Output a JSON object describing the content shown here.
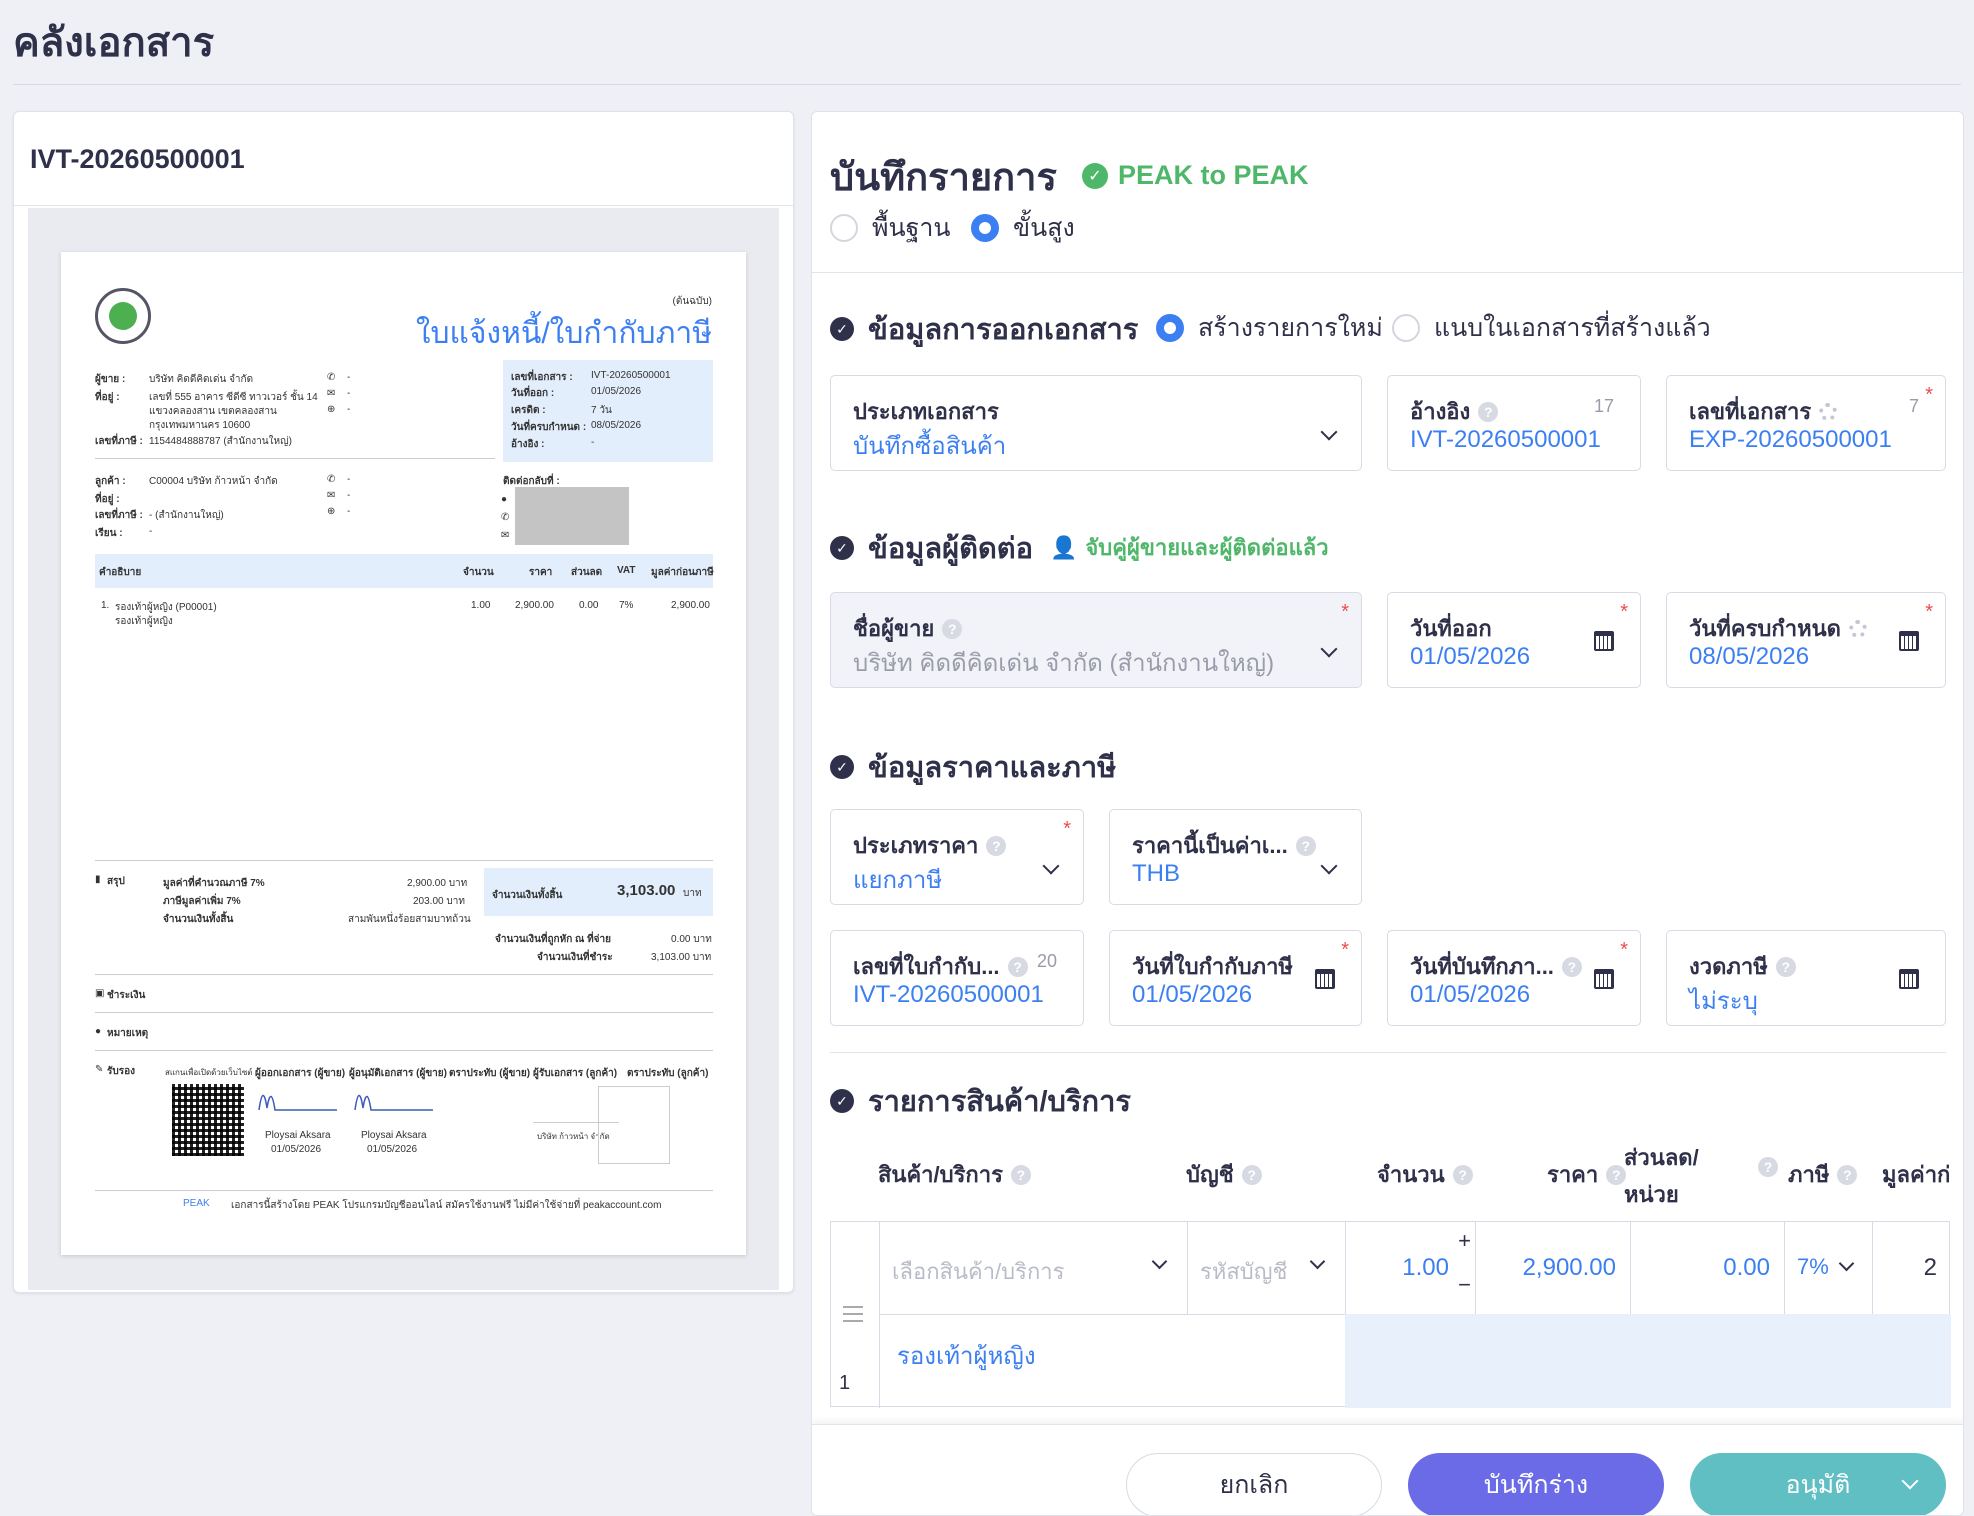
{
  "page": {
    "title": "คลังเอกสาร"
  },
  "preview": {
    "doc_number": "IVT-20260500001",
    "doc": {
      "copy_label": "(ต้นฉบับ)",
      "title": "ใบแจ้งหนี้/ใบกำกับภาษี",
      "seller_label": "ผู้ขาย :",
      "seller": "บริษัท คิดดีคิดเด่น จำกัด",
      "address_label": "ที่อยู่ :",
      "address1": "เลขที่ 555 อาคาร ซีดีซี ทาวเวอร์ ชั้น 14",
      "address2": "แขวงคลองสาน เขตคลองสาน",
      "address3": "กรุงเทพมหานคร 10600",
      "taxid_label": "เลขที่ภาษี :",
      "taxid": "1154484888787 (สำนักงานใหญ่)",
      "contact_dash": "-",
      "info_doc_label": "เลขที่เอกสาร :",
      "info_doc": "IVT-20260500001",
      "info_date_label": "วันที่ออก :",
      "info_date": "01/05/2026",
      "info_credit_label": "เครดิต :",
      "info_credit": "7 วัน",
      "info_due_label": "วันที่ครบกำหนด :",
      "info_due": "08/05/2026",
      "info_ref_label": "อ้างอิง :",
      "info_ref": "-",
      "customer_label": "ลูกค้า :",
      "customer": "C00004 บริษัท ก้าวหน้า จำกัด",
      "cust_addr_label": "ที่อยู่ :",
      "cust_tax_label": "เลขที่ภาษี :",
      "cust_tax": "- (สำนักงานใหญ่)",
      "attn_label": "เรียน :",
      "attn": "-",
      "contact_label": "ติดต่อกลับที่ :",
      "th_desc": "คำอธิบาย",
      "th_qty": "จำนวน",
      "th_price": "ราคา",
      "th_disc": "ส่วนลด",
      "th_vat": "VAT",
      "th_amount": "มูลค่าก่อนภาษี",
      "row_no": "1.",
      "row_name": "รองเท้าผู้หญิง (P00001)",
      "row_sub": "รองเท้าผู้หญิง",
      "row_qty": "1.00",
      "row_price": "2,900.00",
      "row_disc": "0.00",
      "row_vat": "7%",
      "row_amount": "2,900.00",
      "summary_label": "สรุป",
      "sum_base_label": "มูลค่าที่คำนวณภาษี 7%",
      "sum_base": "2,900.00 บาท",
      "sum_vat_label": "ภาษีมูลค่าเพิ่ม 7%",
      "sum_vat": "203.00 บาท",
      "sum_total_label": "จำนวนเงินทั้งสิ้น",
      "sum_words": "สามพันหนึ่งร้อยสามบาทถ้วน",
      "grand_label": "จำนวนเงินทั้งสิ้น",
      "grand_value": "3,103.00",
      "grand_unit": "บาท",
      "wht_label": "จำนวนเงินที่ถูกหัก ณ ที่จ่าย",
      "wht": "0.00 บาท",
      "paid_label": "จำนวนเงินที่ชำระ",
      "paid": "3,103.00 บาท",
      "payment_label": "ชำระเงิน",
      "notes_label": "หมายเหตุ",
      "approve_label": "รับรอง",
      "scan_label": "สแกนเพื่อเปิดด้วยเว็บไซต์",
      "issuer_label": "ผู้ออกเอกสาร (ผู้ขาย)",
      "approver_label": "ผู้อนุมัติเอกสาร (ผู้ขาย)",
      "seller_stamp_label": "ตราประทับ (ผู้ขาย)",
      "receiver_label": "ผู้รับเอกสาร (ลูกค้า)",
      "customer_stamp_label": "ตราประทับ (ลูกค้า)",
      "signer1": "Ploysai Aksara",
      "signer1_date": "01/05/2026",
      "signer2": "Ploysai Aksara",
      "signer2_date": "01/05/2026",
      "receiver_company": "บริษัท ก้าวหน้า จำกัด",
      "footer_brand": "PEAK",
      "footer_text": "เอกสารนี้สร้างโดย PEAK โปรแกรมบัญชีออนไลน์ สมัครใช้งานฟรี ไม่มีค่าใช้จ่ายที่ peakaccount.com"
    }
  },
  "form": {
    "title": "บันทึกรายการ",
    "badge": "PEAK to PEAK",
    "mode_basic": "พื้นฐาน",
    "mode_advanced": "ขั้นสูง",
    "sec_issue": "ข้อมูลการออกเอกสาร",
    "issue_new": "สร้างรายการใหม่",
    "issue_attach": "แนบในเอกสารที่สร้างแล้ว",
    "doc_type_label": "ประเภทเอกสาร",
    "doc_type": "บันทึกซื้อสินค้า",
    "ref_label": "อ้างอิง",
    "ref_count": "17",
    "ref_value": "IVT-20260500001",
    "docno_label": "เลขที่เอกสาร",
    "docno_count": "7",
    "docno_value": "EXP-20260500001",
    "sec_contact": "ข้อมูลผู้ติดต่อ",
    "matched": "จับคู่ผู้ขายและผู้ติดต่อแล้ว",
    "vendor_label": "ชื่อผู้ขาย",
    "vendor_value": "บริษัท คิดดีคิดเด่น จำกัด (สำนักงานใหญ่)",
    "issue_date_label": "วันที่ออก",
    "issue_date": "01/05/2026",
    "due_date_label": "วันที่ครบกำหนด",
    "due_date": "08/05/2026",
    "sec_price": "ข้อมูลราคาและภาษี",
    "price_type_label": "ประเภทราคา",
    "price_type": "แยกภาษี",
    "currency_label": "ราคานี้เป็นค่าเ...",
    "currency": "THB",
    "taxinv_label": "เลขที่ใบกำกับ...",
    "taxinv_count": "20",
    "taxinv_value": "IVT-20260500001",
    "taxinv_date_label": "วันที่ใบกำกับภาษี",
    "taxinv_date": "01/05/2026",
    "record_date_label": "วันที่บันทึกภา...",
    "record_date": "01/05/2026",
    "tax_period_label": "งวดภาษี",
    "tax_period": "ไม่ระบุ",
    "req_mark": "*",
    "qmark": "?",
    "sec_items": "รายการสินค้า/บริการ",
    "col_product": "สินค้า/บริการ",
    "col_account": "บัญชี",
    "col_qty": "จำนวน",
    "col_price": "ราคา",
    "col_disc1": "ส่วนลด/",
    "col_disc2": "หน่วย",
    "col_tax": "ภาษี",
    "col_value": "มูลค่าก่",
    "row": {
      "product_ph": "เลือกสินค้า/บริการ",
      "account_ph": "รหัสบัญชี",
      "qty": "1.00",
      "price": "2,900.00",
      "disc": "0.00",
      "tax": "7%",
      "value": "2",
      "desc": "รองเท้าผู้หญิง",
      "index": "1",
      "plus": "+",
      "minus": "−"
    },
    "btn_cancel": "ยกเลิก",
    "btn_draft": "บันทึกร่าง",
    "btn_approve": "อนุมัติ"
  }
}
